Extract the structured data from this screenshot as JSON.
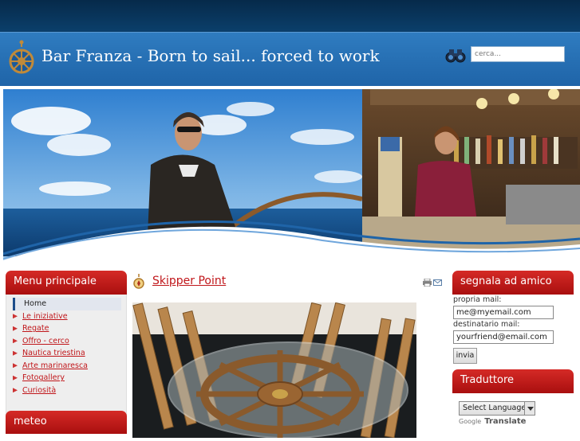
{
  "header": {
    "site_title": "Bar Franza - Born to sail... forced to work",
    "search_placeholder": "cerca..."
  },
  "left": {
    "menu_title": "Menu principale",
    "menu_items": [
      {
        "label": "Home",
        "active": true
      },
      {
        "label": "Le iniziative"
      },
      {
        "label": "Regate"
      },
      {
        "label": "Offro - cerco"
      },
      {
        "label": "Nautica triestina"
      },
      {
        "label": "Arte marinaresca"
      },
      {
        "label": "Fotogallery"
      },
      {
        "label": "Curiosità"
      }
    ],
    "meteo_title": "meteo"
  },
  "article": {
    "title": "Skipper Point"
  },
  "right": {
    "signal_title": "segnala ad amico",
    "own_email_label": "propria mail:",
    "own_email_value": "me@myemail.com",
    "dest_email_label": "destinatario mail:",
    "dest_email_value": "yourfriend@email.com",
    "send_button": "invia",
    "translator_title": "Traduttore",
    "select_language": "Select Language",
    "google_label": "Google",
    "translate_label": "Translate"
  },
  "colors": {
    "header_blue": "#1f64a8",
    "box_red": "#c0161a",
    "link_red": "#c0161a"
  }
}
